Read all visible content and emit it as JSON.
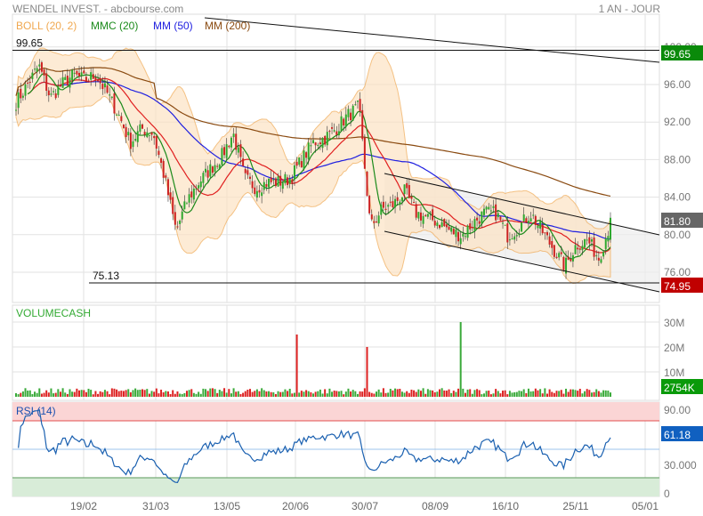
{
  "header": {
    "title": "WENDEL INVEST. - abcbourse.com",
    "period": "1 AN - JOUR"
  },
  "legend": [
    {
      "label": "BOLL (20, 2)",
      "color": "#f0a850"
    },
    {
      "label": "MMC (20)",
      "color": "#1a8a1a"
    },
    {
      "label": "MM (50)",
      "color": "#2020e0"
    },
    {
      "label": "MM (200)",
      "color": "#8a4a10"
    }
  ],
  "chart_data": {
    "type": "candlestick",
    "price_axis": {
      "ticks": [
        "100.00",
        "96.00",
        "92.00",
        "88.00",
        "84.00",
        "80.00",
        "76.00"
      ],
      "tick_values": [
        100,
        96,
        92,
        88,
        84,
        80,
        76
      ],
      "range": [
        74,
        102
      ]
    },
    "x_ticks": [
      "19/02",
      "31/03",
      "13/05",
      "20/06",
      "30/07",
      "08/09",
      "16/10",
      "25/11",
      "05/01"
    ],
    "weekly_closes": [
      94.1,
      96,
      98,
      94.6,
      96,
      97,
      96.5,
      97,
      95,
      92.7,
      89.8,
      91.3,
      90.8,
      86,
      80.4,
      83.7,
      85.6,
      87,
      88.4,
      90.8,
      86,
      85,
      85.6,
      85.6,
      86,
      88,
      89.8,
      90.3,
      91.3,
      92.7,
      93.6,
      80.8,
      82.7,
      83.2,
      84.6,
      82.3,
      81.8,
      81.3,
      80.4,
      79.9,
      81.3,
      82.3,
      82.3,
      79.9,
      80.8,
      82.3,
      80.4,
      78.5,
      76.6,
      78.9,
      79.4,
      77.5,
      81.3
    ],
    "levels": {
      "high": {
        "label": "99.65",
        "value": 99.65
      },
      "low": {
        "label": "75.13",
        "value": 75.13
      }
    },
    "badges": {
      "high": "99.65",
      "last": "81.80",
      "low": "74.95",
      "high_color": "#0a8a0a",
      "last_color": "#666666",
      "low_color": "#c00000"
    },
    "volume": {
      "title": "VOLUMECASH",
      "ticks": [
        "30M",
        "20M",
        "10M"
      ],
      "tick_values": [
        30,
        20,
        10
      ],
      "last": "2754K",
      "last_color": "#0a9a0a",
      "spikes_millions": [
        25,
        20,
        30
      ]
    },
    "rsi": {
      "title": "RSI (14)",
      "ticks": [
        "90.00",
        "30.000",
        "0"
      ],
      "tick_values": [
        90,
        30,
        0
      ],
      "last": "61.18",
      "last_color": "#1060c0"
    }
  }
}
